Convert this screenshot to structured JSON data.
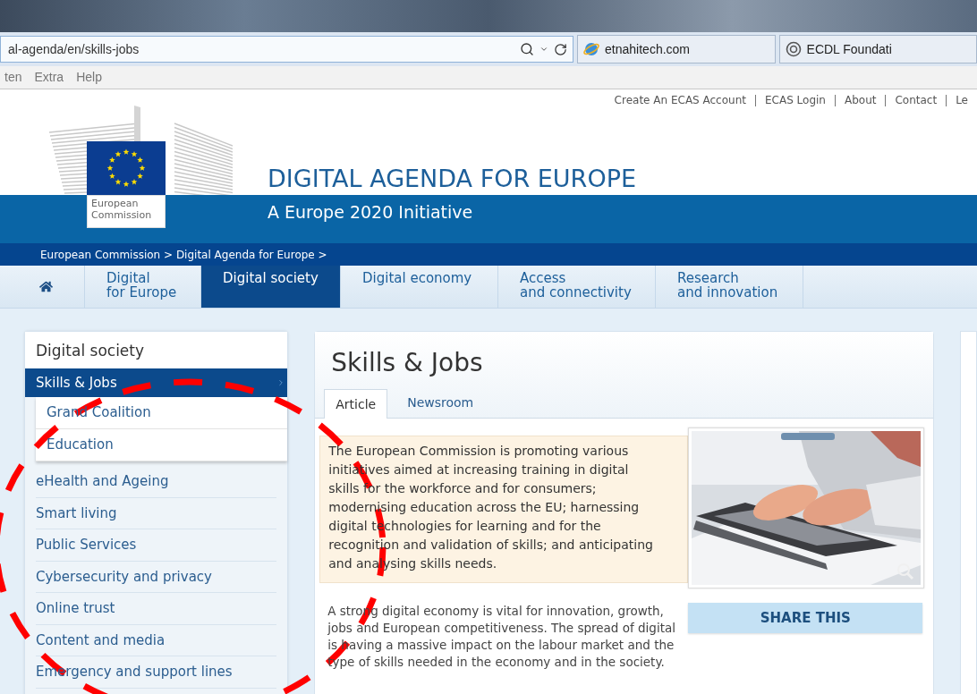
{
  "browser": {
    "address": "al-agenda/en/skills-jobs",
    "tabs": [
      {
        "label": "etnahitech.com",
        "kind": "ie"
      },
      {
        "label": "ECDL Foundati",
        "kind": "ecdl"
      }
    ],
    "menu": [
      "ten",
      "Extra",
      "Help"
    ]
  },
  "top_links": [
    "Create An ECAS Account",
    "ECAS Login",
    "About",
    "Contact",
    "Le"
  ],
  "header": {
    "logo_text": [
      "European",
      "Commission"
    ],
    "title": "DIGITAL AGENDA FOR EUROPE",
    "subtitle": "A Europe 2020 Initiative"
  },
  "breadcrumb": "European Commission > Digital Agenda for Europe >",
  "nav": [
    {
      "kind": "home",
      "selected": false
    },
    {
      "kind": "text",
      "lines": [
        "Digital",
        "for Europe"
      ],
      "selected": false
    },
    {
      "kind": "text",
      "lines": [
        "Digital society"
      ],
      "selected": true
    },
    {
      "kind": "text",
      "lines": [
        "Digital economy"
      ],
      "selected": false
    },
    {
      "kind": "text",
      "lines": [
        "Access",
        "and connectivity"
      ],
      "selected": false
    },
    {
      "kind": "text",
      "lines": [
        "Research",
        "and innovation"
      ],
      "selected": false
    }
  ],
  "sidebar": {
    "title": "Digital society",
    "items": [
      {
        "label": "Skills & Jobs",
        "selected": true,
        "children": [
          {
            "label": "Grand Coalition",
            "selected": false
          },
          {
            "label": "Education",
            "selected": false
          }
        ]
      },
      {
        "label": "eHealth and Ageing",
        "selected": false
      },
      {
        "label": "Smart living",
        "selected": false
      },
      {
        "label": "Public Services",
        "selected": false
      },
      {
        "label": "Cybersecurity and privacy",
        "selected": false
      },
      {
        "label": "Online trust",
        "selected": false
      },
      {
        "label": "Content and media",
        "selected": false
      },
      {
        "label": "Emergency and support lines",
        "selected": false
      }
    ]
  },
  "article": {
    "title": "Skills & Jobs",
    "tabs": [
      {
        "label": "Article",
        "selected": true
      },
      {
        "label": "Newsroom",
        "selected": false
      }
    ],
    "intro": "The European Commission is promoting various initiatives aimed at increasing training in digital skills for the workforce and for consumers; modernising education across the EU; harnessing digital technologies for learning and for the recognition and validation of skills; and anticipating and analysing skills needs.",
    "body": "A strong digital economy is vital for innovation, growth, jobs and European competitiveness. The spread of digital is having a massive impact on the labour market and the type of skills needed in the economy and in the society.",
    "share": "SHARE THIS"
  }
}
